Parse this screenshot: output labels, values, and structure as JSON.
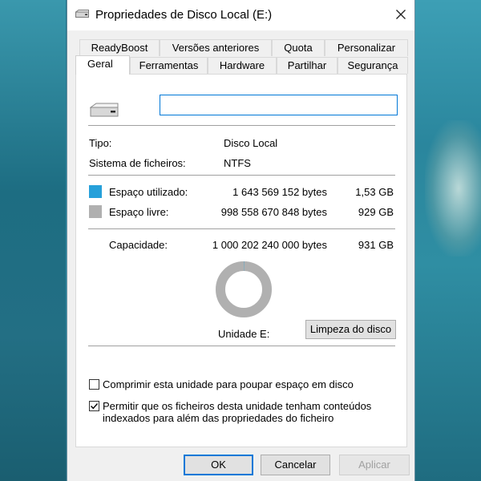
{
  "window": {
    "title": "Propriedades de Disco Local (E:)"
  },
  "tabs_row1": [
    "ReadyBoost",
    "Versões anteriores",
    "Quota",
    "Personalizar"
  ],
  "tabs_row2": [
    "Geral",
    "Ferramentas",
    "Hardware",
    "Partilhar",
    "Segurança"
  ],
  "active_tab": "Geral",
  "volume": {
    "name_value": ""
  },
  "info": {
    "type_label": "Tipo:",
    "type_value": "Disco Local",
    "fs_label": "Sistema de ficheiros:",
    "fs_value": "NTFS"
  },
  "space": {
    "used_label": "Espaço utilizado:",
    "used_bytes": "1 643 569 152 bytes",
    "used_size": "1,53 GB",
    "used_color": "#26a0da",
    "free_label": "Espaço livre:",
    "free_bytes": "998 558 670 848 bytes",
    "free_size": "929 GB",
    "free_color": "#b0b0b0",
    "capacity_label": "Capacidade:",
    "capacity_bytes": "1 000 202 240 000 bytes",
    "capacity_size": "931 GB",
    "used_fraction": 0.0016
  },
  "drive_label": "Unidade E:",
  "cleanup_button": "Limpeza do disco",
  "options": {
    "compress_label": "Comprimir esta unidade para poupar espaço em disco",
    "compress_checked": false,
    "index_label_line1": "Permitir que os ficheiros desta unidade tenham conteúdos",
    "index_label_line2": "indexados para além das propriedades do ficheiro",
    "index_checked": true
  },
  "buttons": {
    "ok": "OK",
    "cancel": "Cancelar",
    "apply": "Aplicar"
  },
  "icons": {
    "close": "close-icon",
    "drive": "drive-icon",
    "check": "check-icon"
  }
}
